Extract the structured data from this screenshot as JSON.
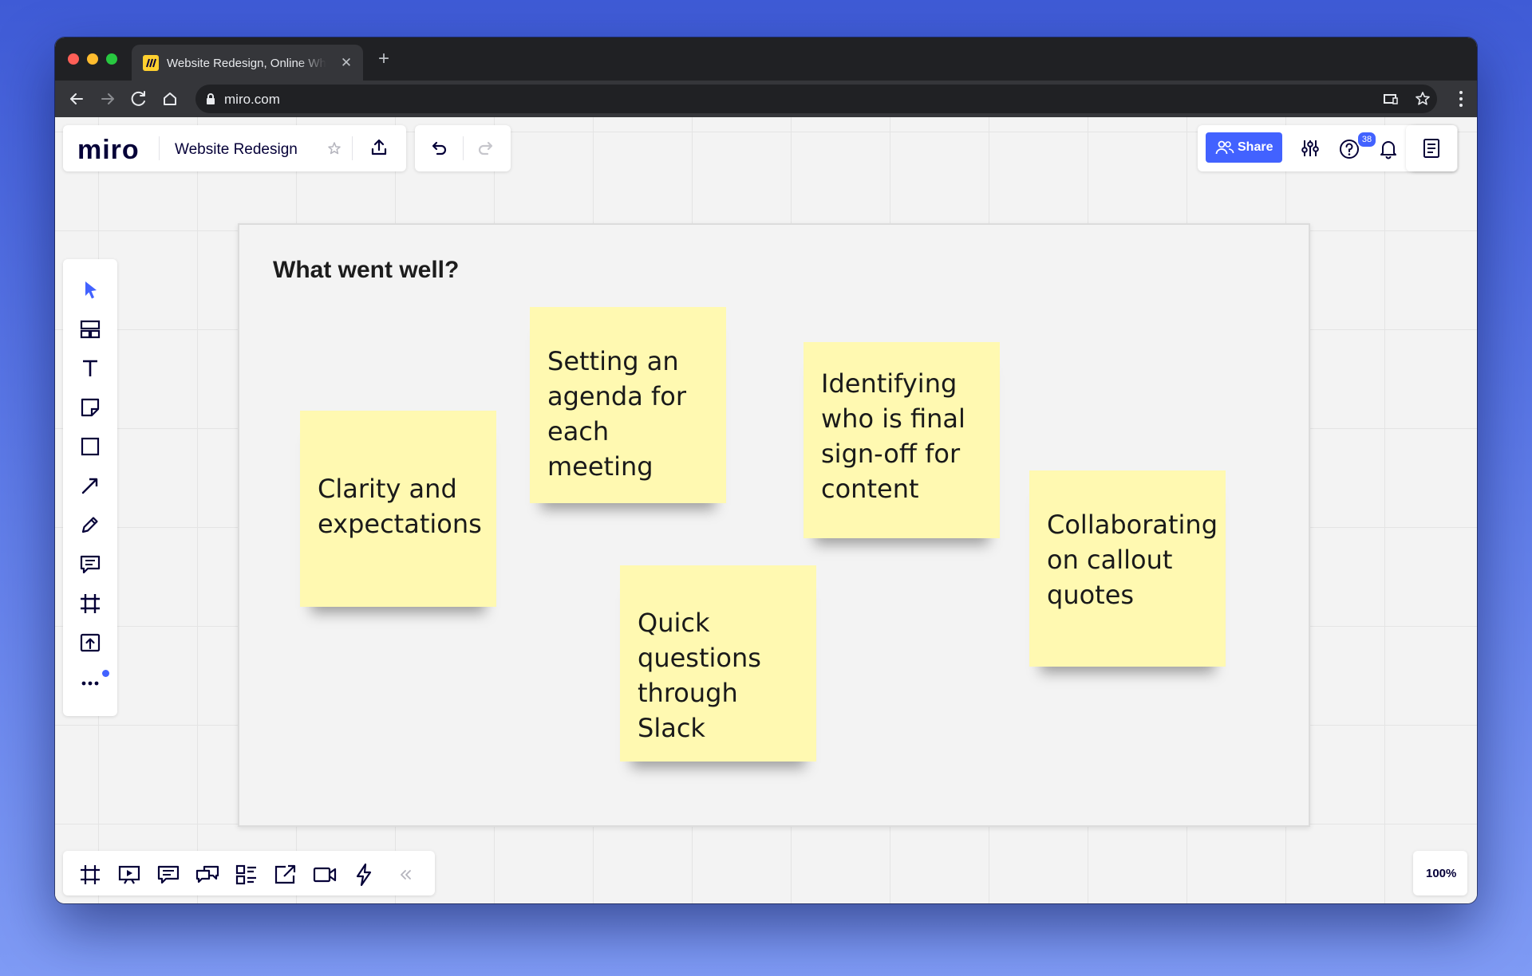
{
  "browser": {
    "tab_title": "Website Redesign, Online Whiteboard for Visual Collaboration",
    "tab_close": "✕",
    "new_tab": "+",
    "url": "miro.com"
  },
  "header": {
    "logo": "miro",
    "board_name": "Website Redesign",
    "share_label": "Share",
    "help_badge": "38"
  },
  "frame": {
    "title": "What went well?"
  },
  "stickies": [
    {
      "text": "Clarity and expectations"
    },
    {
      "text": "Setting an agenda for each meeting"
    },
    {
      "text": "Quick questions through Slack"
    },
    {
      "text": "Identifying who is final sign-off for content"
    },
    {
      "text": "Collaborating on callout quotes"
    }
  ],
  "zoom": {
    "label": "100%"
  },
  "colors": {
    "accent": "#4262ff",
    "sticky": "#fff9b1",
    "toolbar_selected": "#4262ff"
  },
  "icons": {
    "left_toolbar": [
      "select-icon",
      "templates-icon",
      "text-icon",
      "sticky-note-icon",
      "shape-icon",
      "line-icon",
      "pen-icon",
      "comment-icon",
      "frame-icon",
      "upload-icon",
      "more-icon"
    ],
    "bottom_toolbar": [
      "frames-icon",
      "present-icon",
      "comments-icon",
      "chat-icon",
      "cards-icon",
      "share-screen-icon",
      "video-icon",
      "lightning-icon",
      "collapse-icon"
    ]
  }
}
